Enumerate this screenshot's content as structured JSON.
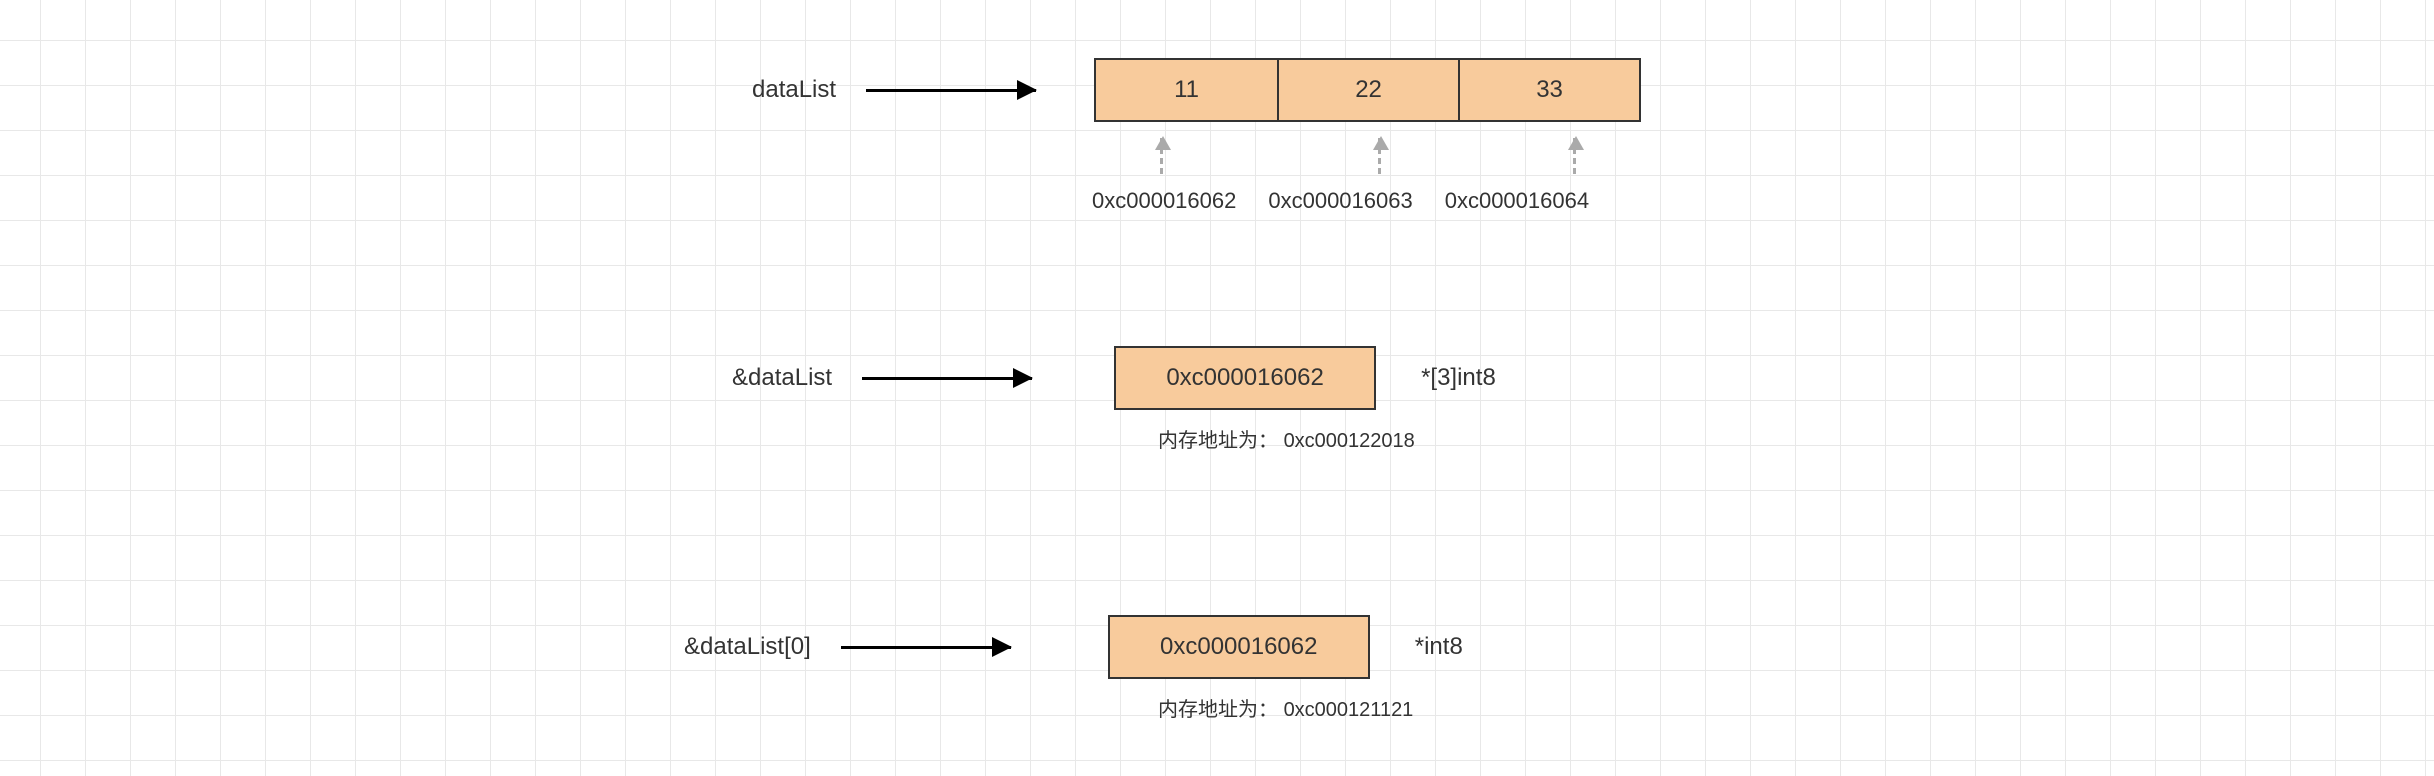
{
  "row1": {
    "label": "dataList",
    "cells": [
      "11",
      "22",
      "33"
    ],
    "addresses": [
      "0xc000016062",
      "0xc000016063",
      "0xc000016064"
    ]
  },
  "row2": {
    "label": "&dataList",
    "box": "0xc000016062",
    "type": "*[3]int8",
    "mem_label": "内存地址为：",
    "mem_value": "0xc000122018"
  },
  "row3": {
    "label": "&dataList[0]",
    "box": "0xc000016062",
    "type": "*int8",
    "mem_label": "内存地址为：",
    "mem_value": "0xc000121121"
  }
}
